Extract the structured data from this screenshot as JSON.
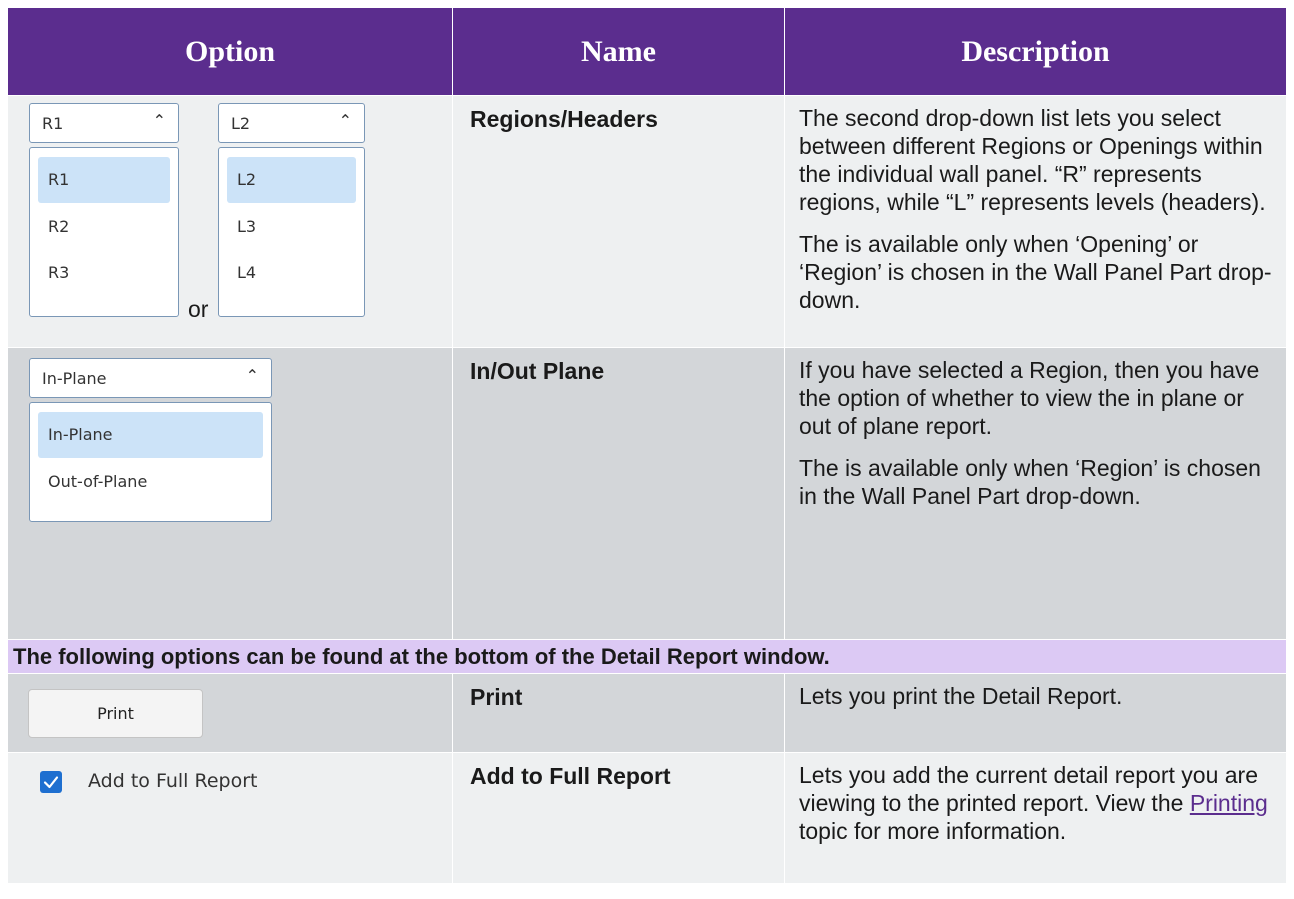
{
  "header": {
    "option": "Option",
    "name": "Name",
    "description": "Description"
  },
  "rows": [
    {
      "name": "Regions/Headers",
      "desc1": "The second drop-down list lets you select between different Regions or Openings within the individual wall panel. “R” represents regions, while “L” represents levels (headers).",
      "desc2": "The is available only when ‘Opening’ or ‘Region’ is chosen in the Wall Panel Part drop-down.",
      "dropdown_r": {
        "selected": "R1",
        "items": [
          "R1",
          "R2",
          "R3"
        ]
      },
      "or": "or",
      "dropdown_l": {
        "selected": "L2",
        "items": [
          "L2",
          "L3",
          "L4"
        ]
      }
    },
    {
      "name": "In/Out Plane",
      "desc1": "If you have selected a Region, then you have the option of whether to view the in plane or out of plane report.",
      "desc2": "The is available only when ‘Region’ is chosen in the Wall Panel Part drop-down.",
      "dropdown": {
        "selected": "In-Plane",
        "items": [
          "In-Plane",
          "Out-of-Plane"
        ]
      }
    }
  ],
  "banner": "The following options can be found at the bottom of the Detail Report window.",
  "print_row": {
    "button": "Print",
    "name": "Print",
    "desc": "Lets you print the Detail Report."
  },
  "full_report_row": {
    "checkbox_label": "Add to Full Report",
    "checked": true,
    "name": "Add to Full Report",
    "desc_a": "Lets you add the current detail report you are viewing to the printed report. View the ",
    "link": "Printing",
    "desc_b": " topic for more information."
  },
  "icons": {
    "chevron": "chevron-up-icon",
    "check": "checkmark-icon"
  },
  "colors": {
    "header_bg": "#5b2d8e",
    "banner_bg": "#dcc9f4",
    "row_light": "#eef0f1",
    "row_dark": "#d3d6d9",
    "accent": "#1e6fd0"
  }
}
